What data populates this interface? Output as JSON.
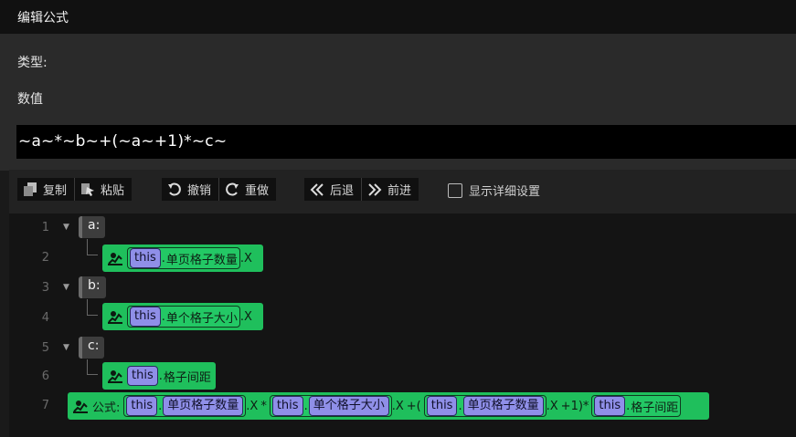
{
  "window": {
    "title": "编辑公式"
  },
  "panel": {
    "type_label": "类型:",
    "value_label": "数值",
    "formula": "~a~*~b~+(~a~+1)*~c~"
  },
  "toolbar": {
    "copy": "复制",
    "paste": "粘贴",
    "undo": "撤销",
    "redo": "重做",
    "back": "后退",
    "forward": "前进",
    "show_details": "显示详细设置"
  },
  "editor": {
    "line_numbers": [
      "1",
      "2",
      "3",
      "4",
      "5",
      "6",
      "7"
    ],
    "vars": [
      {
        "name": "a:",
        "target": "this",
        "dot": ".",
        "prop": "单页格子数量",
        "suffix": ".X"
      },
      {
        "name": "b:",
        "target": "this",
        "dot": ".",
        "prop": "单个格子大小",
        "suffix": ".X"
      },
      {
        "name": "c:",
        "target": "this",
        "dot": ".",
        "prop": "格子间距",
        "suffix": ""
      }
    ],
    "formula_line": {
      "label": "公式:",
      "t1": "this",
      "p1": "单页格子数量",
      "s1": ".X",
      "op1": "*",
      "t2": "this",
      "p2": "单个格子大小",
      "s2": ".X",
      "op2": "+(",
      "t3": "this",
      "p3": "单页格子数量",
      "s3": ".X",
      "op3": "+1)*",
      "t4": "this",
      "p4": "格子间距",
      "dot": "."
    }
  },
  "colors": {
    "block_green": "#1fbf5c",
    "this_pill": "#8f8fe8",
    "formula_bg": "#000000"
  }
}
